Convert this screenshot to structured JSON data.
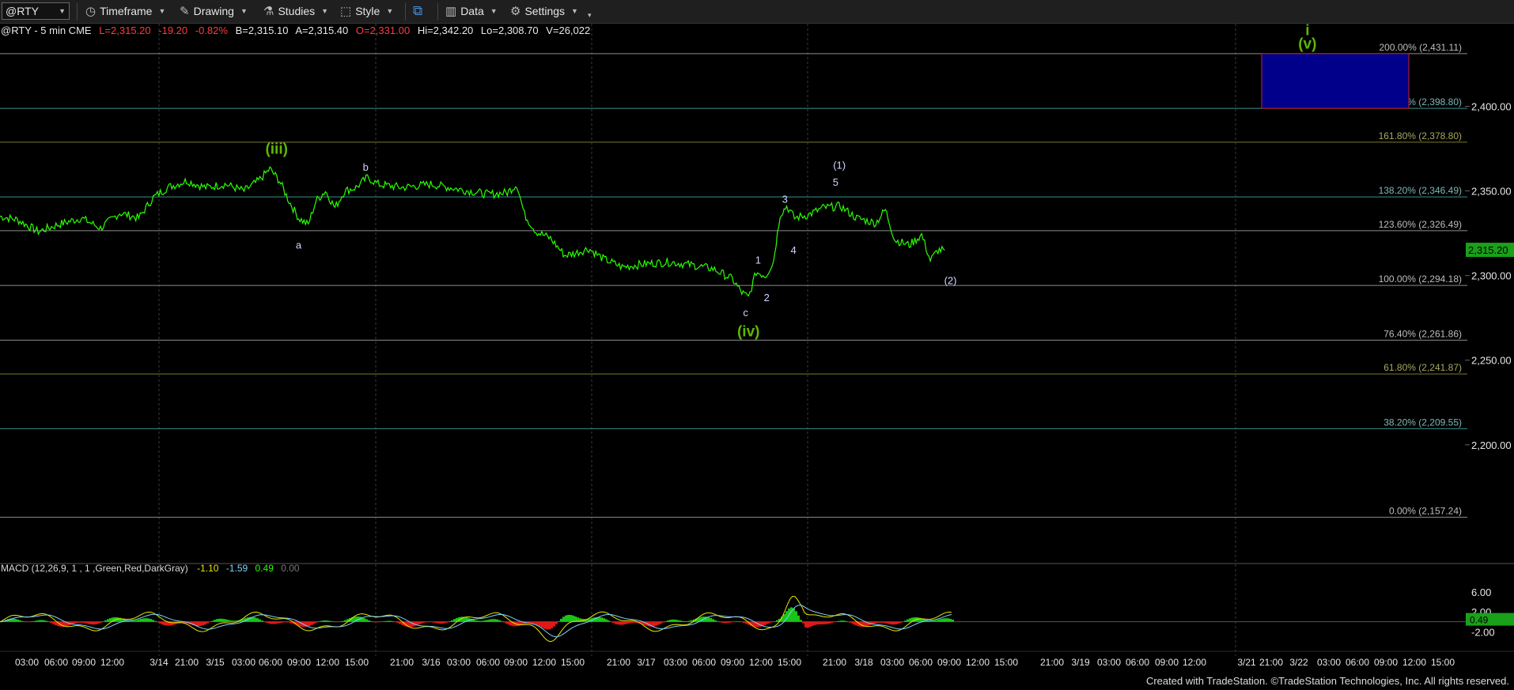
{
  "toolbar": {
    "symbol": "@RTY",
    "timeframe_label": "Timeframe",
    "drawing_label": "Drawing",
    "studies_label": "Studies",
    "style_label": "Style",
    "data_label": "Data",
    "settings_label": "Settings"
  },
  "quote": {
    "symbol_info": "@RTY - 5 min  CME",
    "last": "L=2,315.20",
    "change": "-19.20",
    "pct": "-0.82%",
    "bid": "B=2,315.10",
    "ask": "A=2,315.40",
    "open": "O=2,331.00",
    "high": "Hi=2,342.20",
    "low": "Lo=2,308.70",
    "volume": "V=26,022"
  },
  "colors": {
    "price": "#2aff00",
    "fib_teal": "#2e8b8b",
    "fib_olive": "#6b6b2a",
    "fib_gray": "#8a8a8a",
    "target_box": "#00008b",
    "target_border": "#cc2222",
    "wave_green": "#5fb800"
  },
  "chart_data": {
    "type": "line",
    "title": "@RTY - 5 min",
    "price_axis_ticks": [
      "2,400.00",
      "2,350.00",
      "2,300.00",
      "2,250.00",
      "2,200.00"
    ],
    "ylim": [
      2135,
      2446
    ],
    "last_price_tag": "2,315.20",
    "fib_levels": [
      {
        "label": "200.00% (2,431.11)",
        "price": 2431.11,
        "tone": "gray"
      },
      {
        "label": "176.40% (2,398.80)",
        "price": 2398.8,
        "tone": "teal"
      },
      {
        "label": "161.80% (2,378.80)",
        "price": 2378.8,
        "tone": "olive"
      },
      {
        "label": "138.20% (2,346.49)",
        "price": 2346.49,
        "tone": "teal"
      },
      {
        "label": "123.60% (2,326.49)",
        "price": 2326.49,
        "tone": "gray"
      },
      {
        "label": "100.00% (2,294.18)",
        "price": 2294.18,
        "tone": "gray"
      },
      {
        "label": "76.40% (2,261.86)",
        "price": 2261.86,
        "tone": "gray"
      },
      {
        "label": "61.80% (2,241.87)",
        "price": 2241.87,
        "tone": "olive"
      },
      {
        "label": "38.20% (2,209.55)",
        "price": 2209.55,
        "tone": "teal"
      },
      {
        "label": "0.00% (2,157.24)",
        "price": 2157.24,
        "tone": "gray"
      }
    ],
    "target_zone": {
      "from": 2398.8,
      "to": 2431.11
    },
    "price_path": [
      [
        0,
        2335
      ],
      [
        18,
        2333
      ],
      [
        40,
        2326
      ],
      [
        60,
        2330
      ],
      [
        85,
        2334
      ],
      [
        105,
        2328
      ],
      [
        125,
        2337
      ],
      [
        145,
        2334
      ],
      [
        160,
        2346
      ],
      [
        175,
        2352
      ],
      [
        195,
        2356
      ],
      [
        215,
        2352
      ],
      [
        235,
        2354
      ],
      [
        255,
        2350
      ],
      [
        270,
        2356
      ],
      [
        282,
        2363
      ],
      [
        292,
        2356
      ],
      [
        302,
        2344
      ],
      [
        312,
        2334
      ],
      [
        322,
        2330
      ],
      [
        330,
        2344
      ],
      [
        340,
        2350
      ],
      [
        350,
        2340
      ],
      [
        360,
        2350
      ],
      [
        372,
        2352
      ],
      [
        384,
        2358
      ],
      [
        395,
        2354
      ],
      [
        420,
        2352
      ],
      [
        450,
        2354
      ],
      [
        480,
        2351
      ],
      [
        510,
        2348
      ],
      [
        530,
        2349
      ],
      [
        540,
        2354
      ],
      [
        548,
        2336
      ],
      [
        560,
        2326
      ],
      [
        575,
        2322
      ],
      [
        590,
        2312
      ],
      [
        600,
        2313
      ],
      [
        615,
        2316
      ],
      [
        630,
        2310
      ],
      [
        650,
        2305
      ],
      [
        675,
        2307
      ],
      [
        700,
        2308
      ],
      [
        725,
        2306
      ],
      [
        745,
        2304
      ],
      [
        765,
        2298
      ],
      [
        775,
        2290
      ],
      [
        782,
        2287
      ],
      [
        790,
        2302
      ],
      [
        800,
        2300
      ],
      [
        808,
        2308
      ],
      [
        815,
        2336
      ],
      [
        822,
        2341
      ],
      [
        830,
        2334
      ],
      [
        845,
        2336
      ],
      [
        860,
        2340
      ],
      [
        878,
        2341
      ],
      [
        895,
        2334
      ],
      [
        915,
        2331
      ],
      [
        925,
        2339
      ],
      [
        935,
        2321
      ],
      [
        950,
        2318
      ],
      [
        963,
        2324
      ],
      [
        972,
        2309
      ],
      [
        980,
        2315
      ],
      [
        987,
        2315
      ]
    ],
    "wave_labels": [
      {
        "text": "(iii)",
        "x": 289,
        "price": 2372,
        "big": true
      },
      {
        "text": "b",
        "x": 382,
        "price": 2362,
        "big": false
      },
      {
        "text": "a",
        "x": 312,
        "price": 2316,
        "big": false
      },
      {
        "text": "c",
        "x": 779,
        "price": 2276,
        "big": false
      },
      {
        "text": "(iv)",
        "x": 782,
        "price": 2264,
        "big": true
      },
      {
        "text": "1",
        "x": 792,
        "price": 2307,
        "big": false
      },
      {
        "text": "2",
        "x": 801,
        "price": 2285,
        "big": false
      },
      {
        "text": "3",
        "x": 820,
        "price": 2343,
        "big": false
      },
      {
        "text": "4",
        "x": 829,
        "price": 2313,
        "big": false
      },
      {
        "text": "5",
        "x": 873,
        "price": 2353,
        "big": false
      },
      {
        "text": "(1)",
        "x": 877,
        "price": 2363,
        "big": false
      },
      {
        "text": "(2)",
        "x": 993,
        "price": 2295,
        "big": false
      },
      {
        "text": "(v)",
        "x": 1366,
        "price": 2434,
        "big": true
      },
      {
        "text": "i",
        "x": 1366,
        "price": 2442,
        "big": true
      }
    ],
    "x_axis_labels": [
      "03:00",
      "06:00",
      "09:00",
      "12:00",
      "3/14",
      "21:00",
      "3/15",
      "03:00",
      "06:00",
      "09:00",
      "12:00",
      "15:00",
      "21:00",
      "3/16",
      "03:00",
      "06:00",
      "09:00",
      "12:00",
      "15:00",
      "21:00",
      "3/17",
      "03:00",
      "06:00",
      "09:00",
      "12:00",
      "15:00",
      "21:00",
      "3/18",
      "03:00",
      "06:00",
      "09:00",
      "12:00",
      "15:00",
      "21:00",
      "3/19",
      "03:00",
      "06:00",
      "09:00",
      "12:00",
      "3/21",
      "21:00",
      "3/22",
      "03:00",
      "06:00",
      "09:00",
      "12:00",
      "15:00"
    ],
    "macd": {
      "label": "MACD (12,26,9, 1 , 1 ,Green,Red,DarkGray)",
      "values": [
        "-1.10",
        "-1.59",
        "0.49",
        "0.00"
      ],
      "axis_ticks": [
        "6.00",
        "2.00",
        "-2.00"
      ],
      "current_tag": "0.49",
      "ylim": [
        -4.5,
        9
      ]
    }
  },
  "footer_text": "Created with TradeStation. ©TradeStation Technologies, Inc. All rights reserved."
}
